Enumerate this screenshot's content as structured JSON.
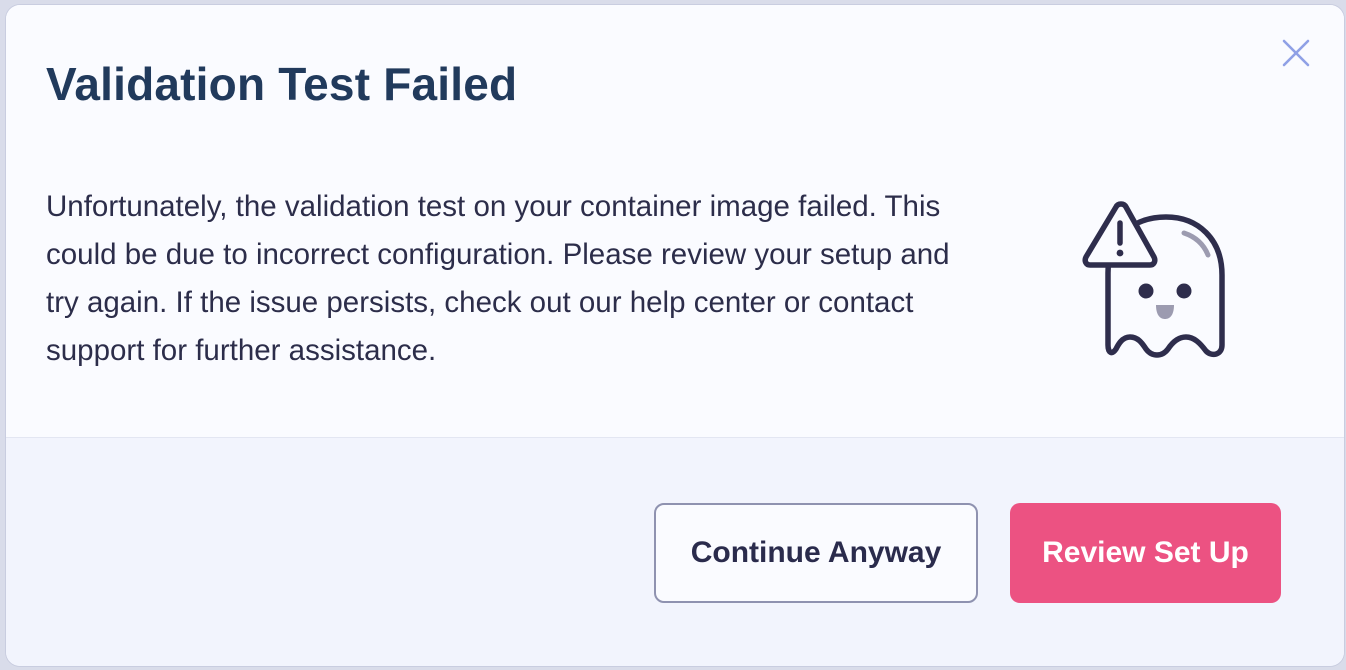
{
  "dialog": {
    "title": "Validation Test Failed",
    "message": "Unfortunately, the validation test on your container image failed. This could be due to incorrect configuration. Please review your setup and try again. If the issue persists, check out our help center or contact support for further assistance.",
    "illustration_icon": "ghost-warning-icon",
    "close_icon": "close-icon"
  },
  "actions": {
    "continue_label": "Continue Anyway",
    "review_label": "Review Set Up"
  },
  "colors": {
    "title": "#213a5c",
    "body_text": "#2c2d4a",
    "primary_button": "#ec5282",
    "close_icon": "#8fa0e6",
    "illustration_stroke": "#2e2d4c"
  }
}
